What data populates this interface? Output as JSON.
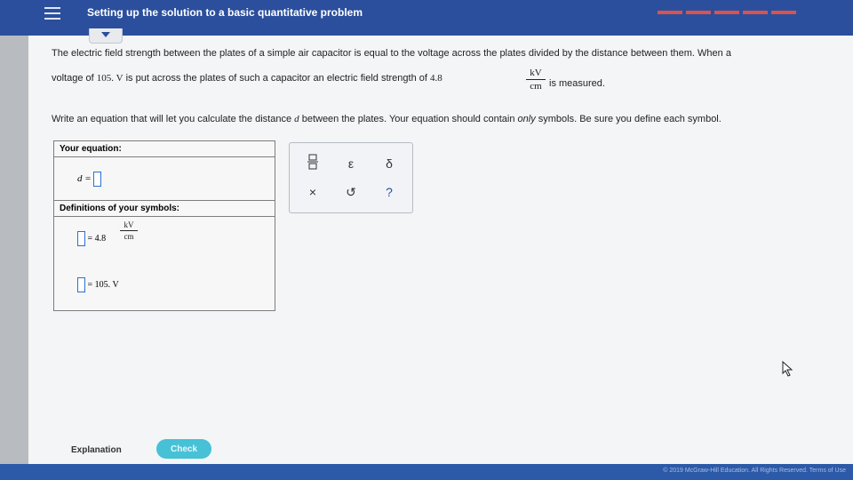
{
  "header": {
    "title": "Setting up the solution to a basic quantitative problem",
    "colors": {
      "bar": "#2b4f9c",
      "progress": "#d9534f"
    }
  },
  "problem": {
    "line1": "The electric field strength between the plates of a simple air capacitor is equal to the voltage across the plates divided by the distance between them. When a",
    "line2_a": "voltage of",
    "voltage_value": "105. V",
    "line2_b": "is put across the plates of such a capacitor an electric field strength of",
    "field_value": "4.8",
    "unit_num": "kV",
    "unit_den": "cm",
    "line2_c": "is measured.",
    "instruction_a": "Write an equation that will let you calculate the distance",
    "instruction_var": "d",
    "instruction_b": "between the plates. Your equation should contain",
    "instruction_emph": "only",
    "instruction_c": "symbols. Be sure you define each symbol."
  },
  "answer_box": {
    "equation_header": "Your equation:",
    "equation_lhs": "d =",
    "definitions_header": "Definitions of your symbols:",
    "def1_value": "= 4.8",
    "def1_unit_num": "kV",
    "def1_unit_den": "cm",
    "def2_value": "= 105. V"
  },
  "palette": {
    "keys": [
      {
        "icon": "fraction-icon",
        "glyph": "▭"
      },
      {
        "icon": "epsilon-icon",
        "glyph": "ε"
      },
      {
        "icon": "delta-icon",
        "glyph": "δ"
      },
      {
        "icon": "clear-icon",
        "glyph": "×"
      },
      {
        "icon": "undo-icon",
        "glyph": "↺"
      },
      {
        "icon": "help-icon",
        "glyph": "?"
      }
    ]
  },
  "footer": {
    "explanation_label": "Explanation",
    "check_label": "Check",
    "copyright": "© 2019 McGraw-Hill Education. All Rights Reserved.   Terms of Use"
  }
}
